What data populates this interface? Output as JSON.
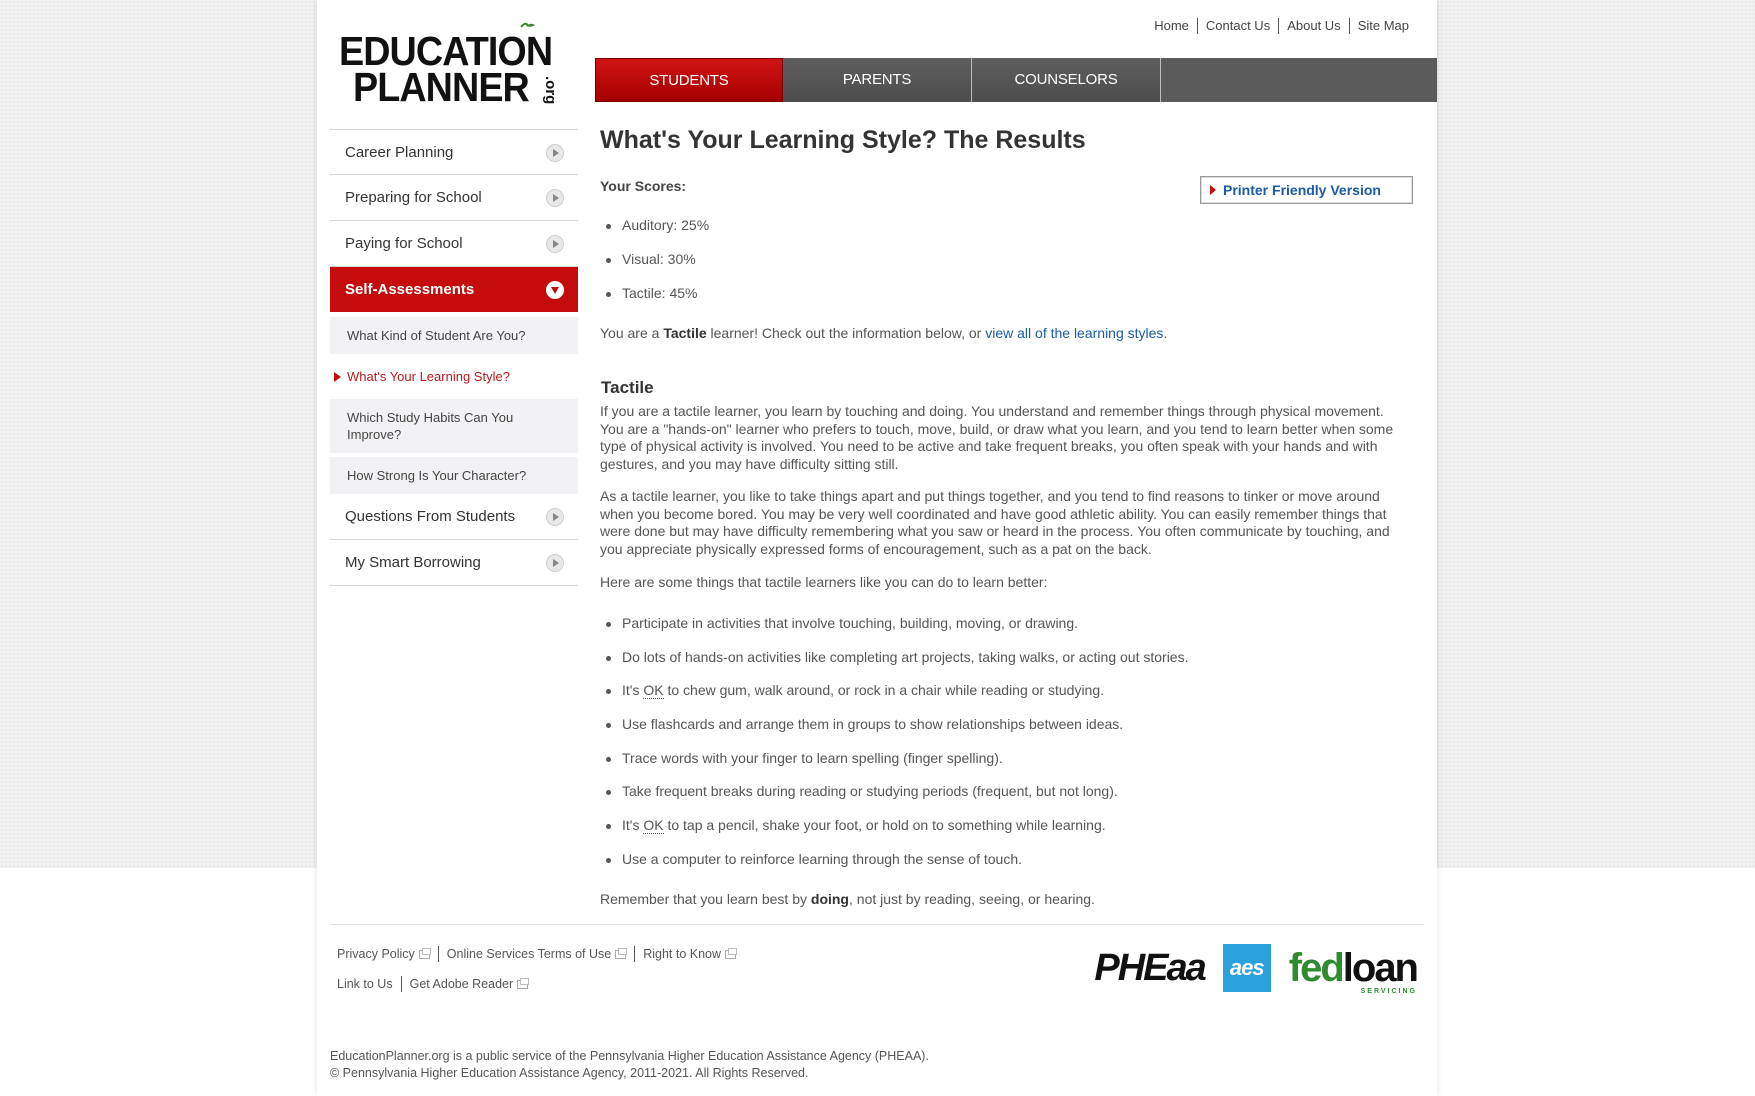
{
  "logo": {
    "line1": "EDUCATION",
    "line2": "PLANNER",
    "suffix": ".org"
  },
  "util_nav": [
    "Home",
    "Contact Us",
    "About Us",
    "Site Map"
  ],
  "tabs": [
    "STUDENTS",
    "PARENTS",
    "COUNSELORS"
  ],
  "sidebar": {
    "items": [
      "Career Planning",
      "Preparing for School",
      "Paying for School",
      "Self-Assessments"
    ],
    "sub_items": [
      "What Kind of Student Are You?",
      "What's Your Learning Style?",
      "Which Study Habits Can You Improve?",
      "How Strong Is Your Character?"
    ],
    "items_after": [
      "Questions From Students",
      "My Smart Borrowing"
    ]
  },
  "content": {
    "title": "What's Your Learning Style? The Results",
    "scores_label": "Your Scores:",
    "printer_button": "Printer Friendly Version",
    "scores": [
      "Auditory: 25%",
      "Visual: 30%",
      "Tactile: 45%"
    ],
    "intro_pre": "You are a ",
    "intro_bold": "Tactile",
    "intro_mid": " learner! Check out the information below, or ",
    "intro_link": "view all of the learning styles",
    "intro_end": ".",
    "section_title": "Tactile",
    "p1": "If you are a tactile learner, you learn by touching and doing. You understand and remember things through physical movement. You are a \"hands-on\" learner who prefers to touch, move, build, or draw what you learn, and you tend to learn better when some type of physical activity is involved. You need to be active and take frequent breaks, you often speak with your hands and with gestures, and you may have difficulty sitting still.",
    "p2": "As a tactile learner, you like to take things apart and put things together, and you tend to find reasons to tinker or move around when you become bored. You may be very well coordinated and have good athletic ability. You can easily remember things that were done but may have difficulty remembering what you saw or heard in the process. You often communicate by touching, and you appreciate physically expressed forms of encouragement, such as a pat on the back.",
    "p3": "Here are some things that tactile learners like you can do to learn better:",
    "tips": [
      "Participate in activities that involve touching, building, moving, or drawing.",
      "Do lots of hands-on activities like completing art projects, taking walks, or acting out stories.",
      "It's OK to chew gum, walk around, or rock in a chair while reading or studying.",
      "Use flashcards and arrange them in groups to show relationships between ideas.",
      "Trace words with your finger to learn spelling (finger spelling).",
      "Take frequent breaks during reading or studying periods (frequent, but not long).",
      "It's OK to tap a pencil, shake your foot, or hold on to something while learning.",
      "Use a computer to reinforce learning through the sense of touch."
    ],
    "closing_pre": "Remember that you learn best by ",
    "closing_bold": "doing",
    "closing_end": ", not just by reading, seeing, or hearing."
  },
  "footer": {
    "links_row1": [
      "Privacy Policy",
      "Online Services Terms of Use",
      "Right to Know"
    ],
    "links_row2": [
      "Link to Us",
      "Get Adobe Reader"
    ],
    "partners": {
      "pheaa": "PHEaa",
      "aes": "aes",
      "fedloan_fed": "fed",
      "fedloan_loan": "loan",
      "fedloan_servicing": "SERVICING"
    },
    "copyright_line1": "EducationPlanner.org is a public service of the Pennsylvania Higher Education Assistance Agency (PHEAA).",
    "copyright_line2": "© Pennsylvania Higher Education Assistance Agency, 2011-2021. All Rights Reserved."
  },
  "colors": {
    "brand_red": "#c40c0c",
    "link_blue": "#1a5aa8",
    "tab_gray": "#5b5b5b"
  }
}
